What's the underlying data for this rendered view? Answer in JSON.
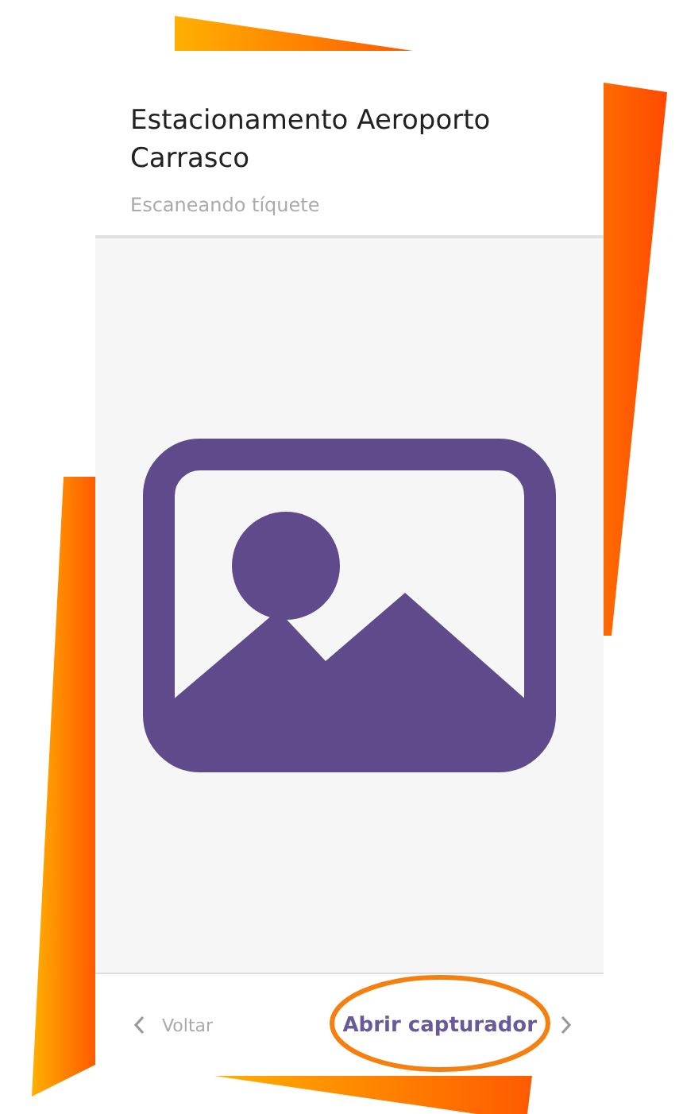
{
  "header": {
    "title": "Estacionamento Aeroporto Carrasco",
    "subtitle": "Escaneando tíquete"
  },
  "footer": {
    "back": {
      "label": "Voltar"
    },
    "primary": {
      "label": "Abrir capturador",
      "highlighted": true
    }
  }
}
